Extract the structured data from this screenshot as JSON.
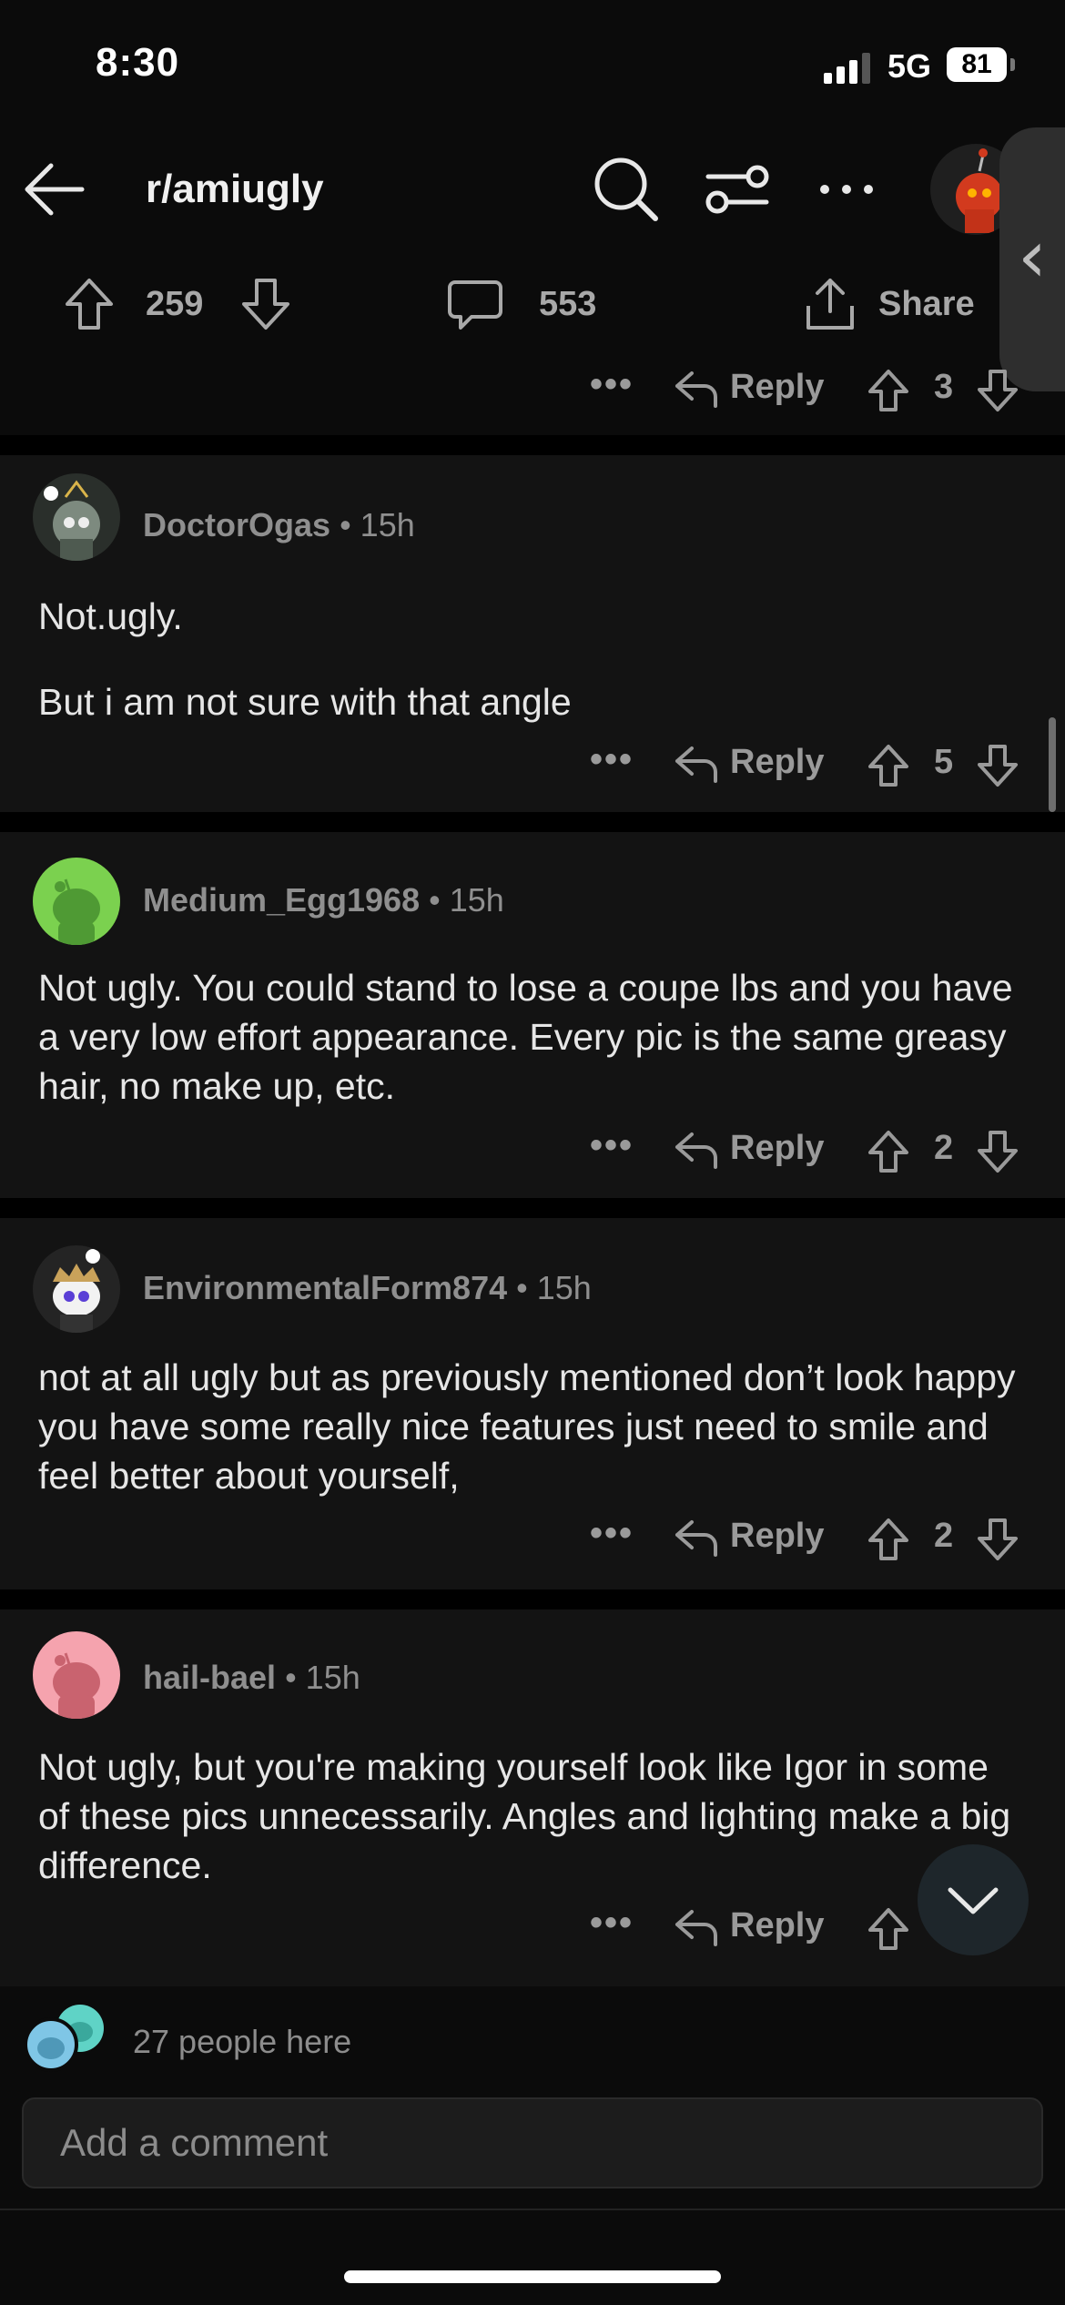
{
  "status_bar": {
    "time": "8:30",
    "network": "5G",
    "battery": "81"
  },
  "header": {
    "subreddit": "r/amiugly"
  },
  "post": {
    "score": "259",
    "comments": "553",
    "share_label": "Share"
  },
  "top_actions": {
    "reply_label": "Reply",
    "votes": "3"
  },
  "comments": [
    {
      "author": "DoctorOgas",
      "time": "• 15h",
      "paragraphs": [
        "Not.ugly.",
        "But i am not sure with that angle"
      ],
      "reply_label": "Reply",
      "votes": "5"
    },
    {
      "author": "Medium_Egg1968",
      "time": "• 15h",
      "paragraphs": [
        "Not ugly. You could stand to lose a coupe lbs and you have a very low effort appearance. Every pic is the same greasy hair, no make up, etc."
      ],
      "reply_label": "Reply",
      "votes": "2"
    },
    {
      "author": "EnvironmentalForm874",
      "time": "• 15h",
      "paragraphs": [
        "not at all ugly but as previously mentioned don’t look happy you have some really nice features just need to smile and feel better about yourself,"
      ],
      "reply_label": "Reply",
      "votes": "2"
    },
    {
      "author": "hail-bael",
      "time": "• 15h",
      "paragraphs": [
        "Not ugly, but you're making yourself look like Igor in some of these pics unnecessarily. Angles and lighting make a big difference."
      ],
      "reply_label": "Reply",
      "votes": ""
    }
  ],
  "footer": {
    "people_here": "27 people here",
    "comment_placeholder": "Add a comment"
  },
  "colors": {
    "background": "#0b0b0b",
    "card": "#131313",
    "text": "#e6e6e6",
    "muted": "#8f8f8f"
  }
}
